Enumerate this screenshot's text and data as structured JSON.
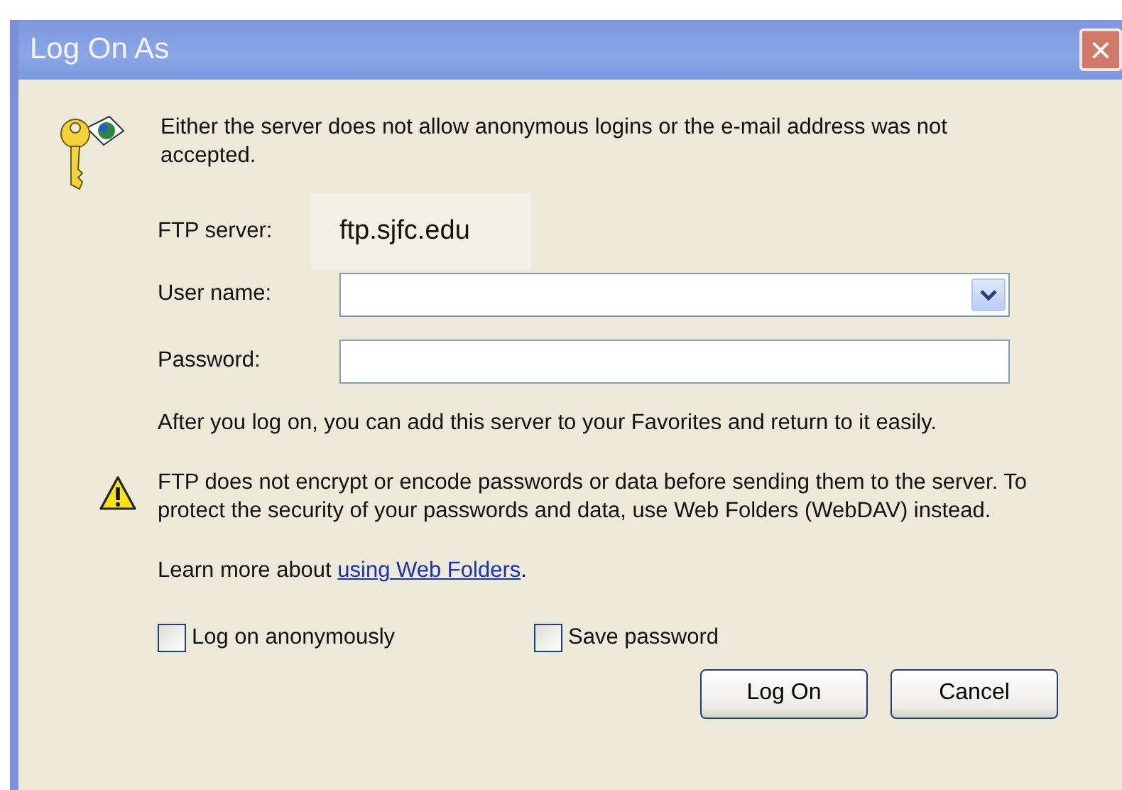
{
  "window": {
    "title": "Log On As",
    "close": "×"
  },
  "message": "Either the server does not allow anonymous logins or the e-mail address was not accepted.",
  "fields": [
    {
      "kind": "readonly",
      "label": "FTP server:",
      "value": "ftp.sjfc.edu"
    },
    {
      "kind": "combo",
      "label": "User name:"
    },
    {
      "kind": "password",
      "label": "Password:"
    }
  ],
  "info": "After you log on, you can add this server to your Favorites and return to it easily.",
  "warning": "FTP does not encrypt or encode passwords or data before sending them to the server.  To protect the security of your passwords and data, use Web Folders (WebDAV) instead.",
  "learn_more": {
    "before": "Learn more about ",
    "link": "using Web Folders",
    "after": "."
  },
  "checkboxes": [
    {
      "label": "Log on anonymously",
      "checked": false
    },
    {
      "label": "Save password",
      "checked": false
    }
  ],
  "buttons": [
    {
      "label": "Log On"
    },
    {
      "label": "Cancel"
    }
  ]
}
